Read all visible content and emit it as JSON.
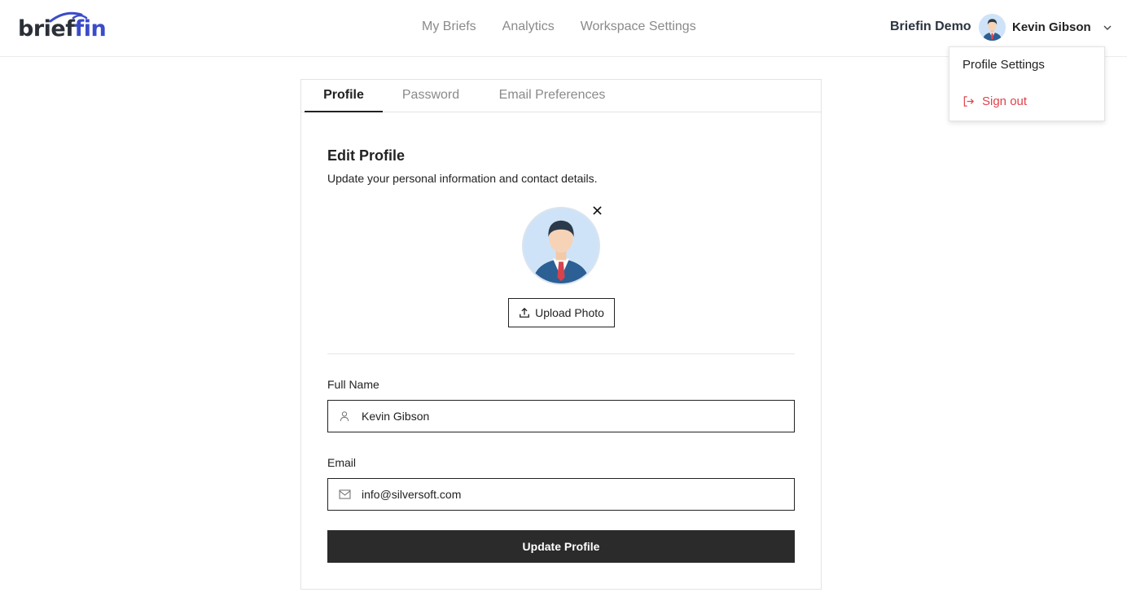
{
  "brand": {
    "logo_prefix": "brief",
    "logo_suffix": "in",
    "accent_color": "#3a4cc9",
    "logo_icon": "wifi-arc-logo"
  },
  "nav": {
    "items": [
      {
        "label": "My Briefs"
      },
      {
        "label": "Analytics"
      },
      {
        "label": "Workspace Settings"
      }
    ]
  },
  "header": {
    "workspace_name": "Briefin Demo",
    "user_name": "Kevin Gibson",
    "user_menu_icon": "chevron-down-icon"
  },
  "dropdown": {
    "profile_settings": "Profile Settings",
    "sign_out": "Sign out",
    "sign_out_icon": "sign-out-icon",
    "sign_out_color": "#e0424b"
  },
  "tabs": [
    {
      "label": "Profile",
      "active": true
    },
    {
      "label": "Password",
      "active": false
    },
    {
      "label": "Email Preferences",
      "active": false
    }
  ],
  "profile": {
    "title": "Edit Profile",
    "subtitle": "Update your personal information and contact details.",
    "remove_photo_icon": "close-icon",
    "upload_label": "Upload Photo",
    "upload_icon": "upload-icon"
  },
  "form": {
    "full_name_label": "Full Name",
    "full_name_value": "Kevin Gibson",
    "full_name_icon": "user-icon",
    "email_label": "Email",
    "email_value": "info@silversoft.com",
    "email_icon": "mail-icon",
    "submit_label": "Update Profile"
  }
}
